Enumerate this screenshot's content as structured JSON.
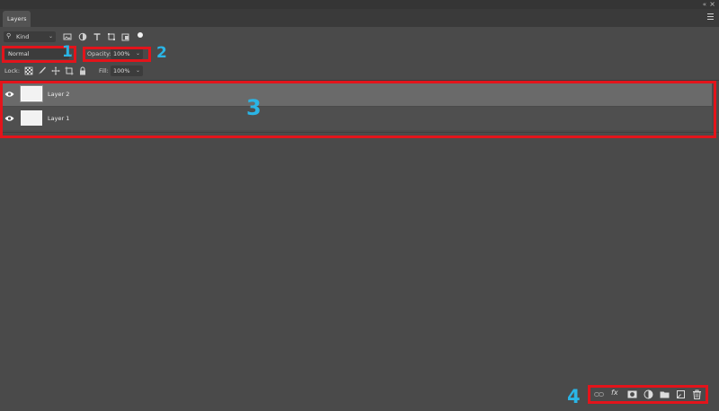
{
  "window": {
    "collapse_label": "«",
    "close_label": "×"
  },
  "panel": {
    "tab_label": "Layers",
    "menu_icon": "hamburger-menu-icon"
  },
  "filter": {
    "kind_label": "Kind",
    "icons": [
      "pixel-layer-filter-icon",
      "adjustment-layer-filter-icon",
      "type-layer-filter-icon",
      "shape-layer-filter-icon",
      "smart-object-filter-icon",
      "filter-toggle-dot-icon"
    ]
  },
  "blend": {
    "mode": "Normal",
    "opacity_label": "Opacity:",
    "opacity_value": "100%"
  },
  "lock": {
    "label": "Lock:",
    "icons": [
      "lock-transparent-pixels-icon",
      "lock-image-pixels-icon",
      "lock-position-icon",
      "lock-artboard-icon",
      "lock-all-icon"
    ],
    "fill_label": "Fill:",
    "fill_value": "100%"
  },
  "layers": [
    {
      "name": "Layer 2",
      "selected": true,
      "visible": true
    },
    {
      "name": "Layer 1",
      "selected": false,
      "visible": true
    }
  ],
  "footer": {
    "icons": [
      "link-layers-icon",
      "layer-style-fx-icon",
      "add-mask-icon",
      "new-adjustment-layer-icon",
      "new-group-icon",
      "new-layer-icon",
      "delete-layer-icon"
    ],
    "fx_label": "fx"
  },
  "annotations": {
    "highlight_color": "#e3141b",
    "callout_color": "#2ab5e6",
    "labels": [
      "1",
      "2",
      "3",
      "4"
    ]
  }
}
